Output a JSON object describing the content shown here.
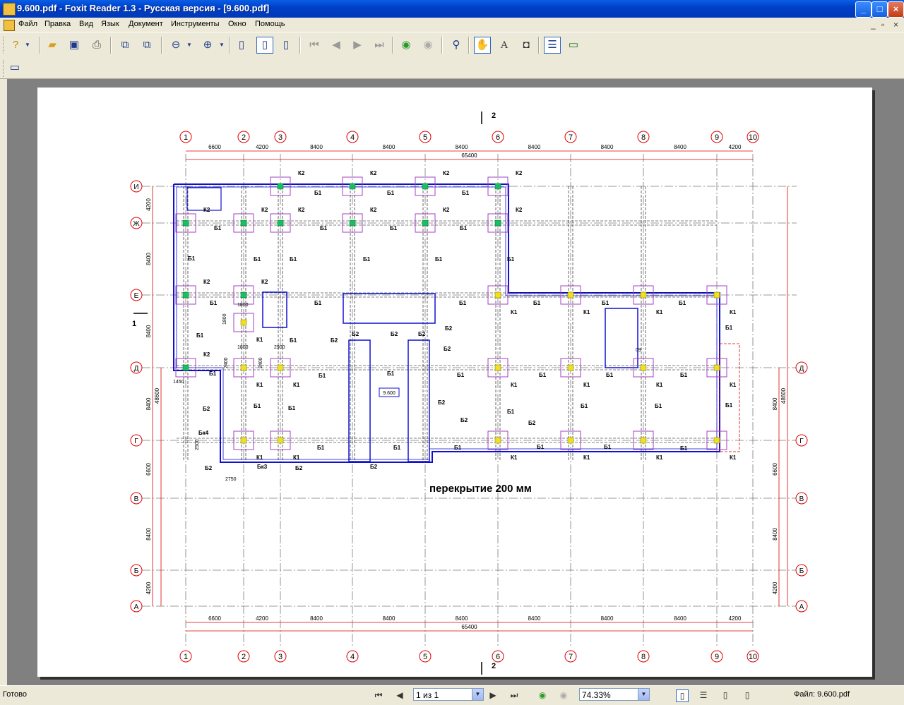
{
  "window": {
    "title": "9.600.pdf - Foxit Reader 1.3 - Русская версия  - [9.600.pdf]",
    "minimize": "_",
    "maximize": "□",
    "close": "×"
  },
  "menu": {
    "items": [
      "Файл",
      "Правка",
      "Вид",
      "Язык",
      "Документ",
      "Инструменты",
      "Окно",
      "Помощь"
    ],
    "mdi_controls": [
      "_",
      "▫",
      "×"
    ]
  },
  "toolbar": {
    "icons": [
      "help-icon",
      "open-folder-icon",
      "save-icon",
      "print-icon",
      "copy-page-icon",
      "paste-page-icon",
      "zoom-out-icon",
      "zoom-in-icon",
      "single-page-icon",
      "fit-page-icon",
      "fit-width-icon",
      "first-page-icon",
      "prev-page-icon",
      "next-page-icon",
      "last-page-icon",
      "back-icon",
      "forward-icon",
      "find-icon",
      "hand-tool-icon",
      "text-select-icon",
      "snapshot-icon",
      "bookmarks-panel-icon",
      "full-screen-icon"
    ]
  },
  "drawing": {
    "section_mark_top": "2",
    "section_mark_left": "1",
    "column_labels": [
      "1",
      "2",
      "3",
      "4",
      "5",
      "6",
      "7",
      "8",
      "9",
      "10"
    ],
    "row_labels": [
      "И",
      "Ж",
      "Е",
      "Д",
      "Г",
      "В",
      "Б",
      "А"
    ],
    "right_row_labels": [
      "Д",
      "Г",
      "В",
      "Б",
      "А"
    ],
    "top_spans": [
      "6600",
      "4200",
      "8400",
      "8400",
      "8400",
      "8400",
      "8400",
      "8400",
      "4200"
    ],
    "total_span": "65400",
    "left_spans": [
      "4200",
      "8400",
      "8400",
      "8400",
      "6600",
      "8400",
      "4200"
    ],
    "total_height": "48600",
    "right_spans": [
      "8400",
      "6600",
      "8400",
      "4200"
    ],
    "right_total": "48600",
    "caption": "перекрытие 200 мм",
    "mark_label": "9.600",
    "labels": {
      "k1": "К1",
      "k2": "К2",
      "b1": "Б1",
      "b2": "Б2",
      "bk3": "Бк3",
      "bk4": "Бк4",
      "dim_1450": "1450",
      "dim_1800": "1800",
      "dim_2400": "2400",
      "dim_2900": "2900",
      "dim_2500": "2500",
      "dim_2750": "2750",
      "dim_1800b": "1800",
      "dim_2400b": "2400",
      "dim_09": "09"
    }
  },
  "status": {
    "ready": "Готово",
    "page_field": "1 из 1",
    "zoom_field": "74.33%",
    "file_info": "Файл: 9.600.pdf"
  }
}
